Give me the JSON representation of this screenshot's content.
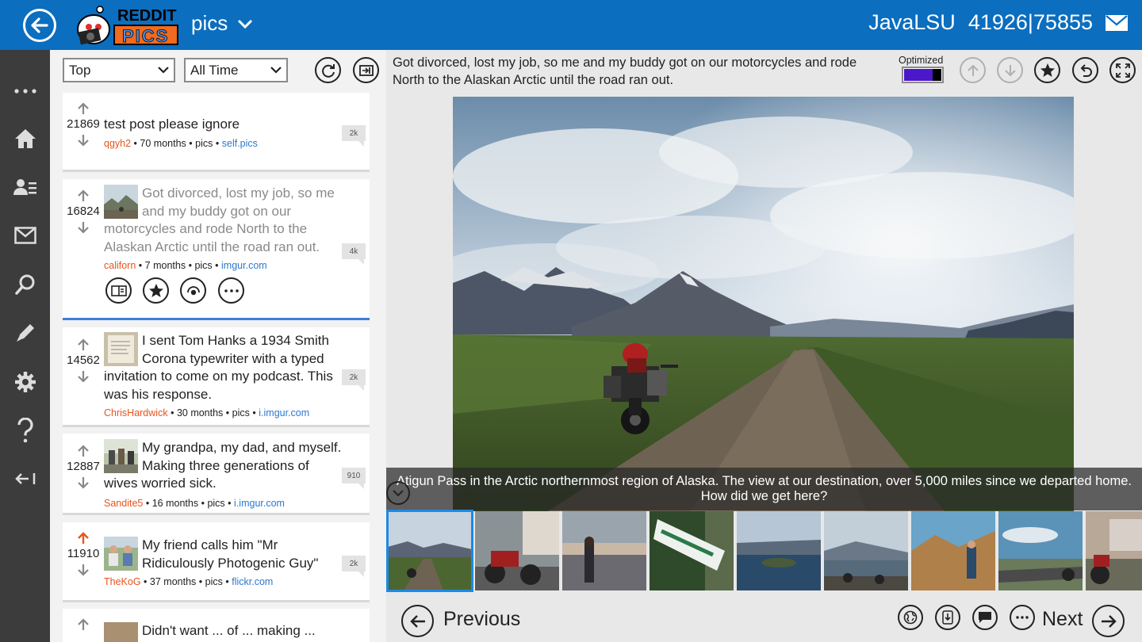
{
  "header": {
    "logo_top": "REDDIT",
    "logo_bottom": "PICS",
    "subreddit": "pics",
    "username": "JavaLSU",
    "karma": "41926|75855"
  },
  "rail": {
    "items": [
      "more-icon",
      "home-icon",
      "profile-icon",
      "mail-icon",
      "search-icon",
      "edit-icon",
      "settings-icon",
      "help-icon",
      "collapse-icon"
    ]
  },
  "list": {
    "sort_value": "Top",
    "time_value": "All Time",
    "posts": [
      {
        "score": "21869",
        "title": "test post please ignore",
        "author": "qgyh2",
        "age": "70 months",
        "sub": "pics",
        "domain": "self.pics",
        "comments": "2k"
      },
      {
        "score": "16824",
        "title": "Got divorced, lost my job, so me and my buddy got on our motorcycles and rode North to the Alaskan Arctic until the road ran out.",
        "author": "californ",
        "age": "7 months",
        "sub": "pics",
        "domain": "imgur.com",
        "comments": "4k"
      },
      {
        "score": "14562",
        "title": "I sent Tom Hanks a 1934 Smith Corona typewriter with a typed invitation to come on my podcast. This was his response.",
        "author": "ChrisHardwick",
        "age": "30 months",
        "sub": "pics",
        "domain": "i.imgur.com",
        "comments": "2k"
      },
      {
        "score": "12887",
        "title": "My grandpa, my dad, and myself. Making three generations of wives worried sick.",
        "author": "Sandite5",
        "age": "16 months",
        "sub": "pics",
        "domain": "i.imgur.com",
        "comments": "910"
      },
      {
        "score": "11910",
        "title": "My friend calls him \"Mr Ridiculously Photogenic Guy\"",
        "author": "TheKoG",
        "age": "37 months",
        "sub": "pics",
        "domain": "flickr.com",
        "comments": "2k"
      },
      {
        "score": "",
        "title": "Didn't want ... of ... making ...",
        "author": "",
        "age": "",
        "sub": "",
        "domain": "",
        "comments": ""
      }
    ],
    "bullet": "•"
  },
  "viewer": {
    "title": "Got divorced, lost my job, so me and my buddy got on our motorcycles and rode North to the Alaskan Arctic until the road ran out.",
    "optimized_label": "Optimized",
    "optimized_on": true,
    "caption_line1": "Atigun Pass in the Arctic northernmost region of Alaska. The view at our destination, over 5,000 miles since we departed home.",
    "caption_line2": "How did we get here?",
    "selected_index": 0,
    "previous_label": "Previous",
    "next_label": "Next"
  },
  "colors": {
    "header_bg": "#0b6ebf",
    "rail_bg": "#3c3c3c",
    "author": "#e8541c",
    "domain": "#2b78d0",
    "upvoted": "#e8541c",
    "selection": "#1c8ae8",
    "toggle_fill": "#4a18c8"
  }
}
